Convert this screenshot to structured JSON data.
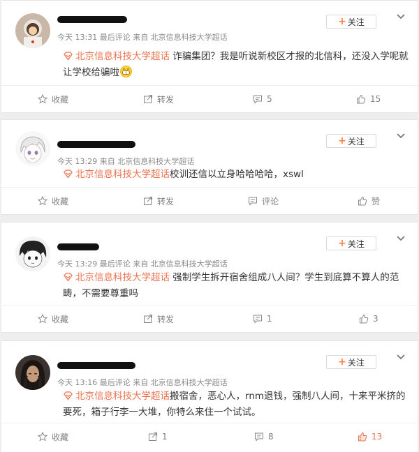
{
  "posts": [
    {
      "meta": "今天 13:31 最后评论 来自 北京信息科技大学超话",
      "follow_label": "关注",
      "topic": "北京信息科技大学超话",
      "text": " 诈骗集团？我是听说新校区才报的北信科，还没入学呢就让学校给骗啦",
      "actions": {
        "favorite": "收藏",
        "repost": "转发",
        "comment": "5",
        "like": "15"
      }
    },
    {
      "meta": "今天 13:29 来自 北京信息科技大学超话",
      "follow_label": "关注",
      "topic": "北京信息科技大学超话",
      "text": "校训还信以立身哈哈哈哈，xswl",
      "actions": {
        "favorite": "收藏",
        "repost": "转发",
        "comment": "评论",
        "like": "赞"
      }
    },
    {
      "meta": "今天 13:29 最后评论 来自 北京信息科技大学超话",
      "follow_label": "关注",
      "topic": "北京信息科技大学超话",
      "text": " 强制学生拆开宿舍组成八人间？学生到底算不算人的范畴，不需要尊重吗",
      "actions": {
        "favorite": "收藏",
        "repost": "转发",
        "comment": "1",
        "like": "3"
      }
    },
    {
      "meta": "今天 13:16 最后评论 来自 北京信息科技大学超话",
      "follow_label": "关注",
      "topic": "北京信息科技大学超话",
      "text": "搬宿舍，恶心人，rnm退钱，强制八人间，十来平米挤的要死，箱子行李一大堆，你特么来住一个试试。",
      "actions": {
        "favorite": "收藏",
        "repost": "1",
        "comment": "8",
        "like": "13"
      }
    }
  ],
  "icons": {
    "topic": "supertopic-diamond-icon",
    "follow": "plus-icon",
    "menu": "chevron-down-icon",
    "favorite": "star-icon",
    "repost": "share-arrow-icon",
    "comment": "speech-bubble-icon",
    "like": "thumbs-up-icon",
    "emoji": "grin-emoji-icon"
  },
  "colors": {
    "accent": "#eb7350",
    "follow_plus": "#ff8140",
    "liked": "#eb7350"
  }
}
